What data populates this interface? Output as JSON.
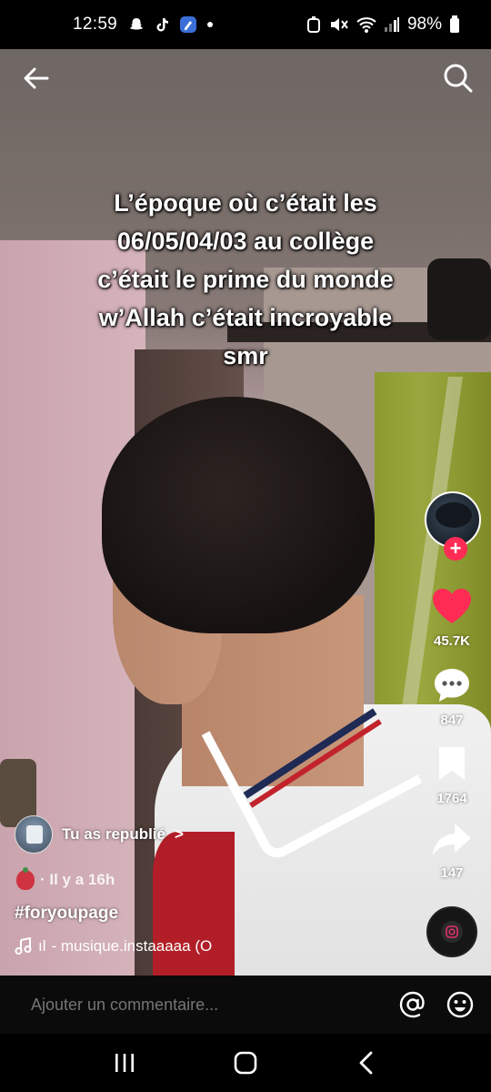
{
  "status_bar": {
    "time": "12:59",
    "battery": "98%",
    "notification_icons": [
      "snapchat-icon",
      "tiktok-icon",
      "app-icon",
      "dot-icon"
    ],
    "system_icons": [
      "alarm-icon",
      "mute-icon",
      "wifi-icon",
      "signal-icon",
      "battery-icon"
    ]
  },
  "top_nav": {
    "back_icon": "back-arrow-icon",
    "search_icon": "search-icon"
  },
  "video": {
    "caption_lines": [
      "L’époque où c’était les",
      "06/05/04/03 au collège",
      "c’était le prime du monde",
      "w’Allah c’était incroyable",
      "smr"
    ]
  },
  "rail": {
    "likes": "45.7K",
    "comments": "847",
    "bookmarks": "1764",
    "shares": "147",
    "follow_symbol": "+"
  },
  "post": {
    "repost_label": "Tu as republié",
    "repost_chevron": ">",
    "time_ago": "· Il y a 16h",
    "hashtag": "#foryoupage",
    "music_prefix": "ıl",
    "music_text": "- musique.instaaaaa (O"
  },
  "comment_bar": {
    "placeholder": "Ajouter un commentaire..."
  },
  "colors": {
    "like_red": "#fe2c55",
    "follow_red": "#fe2c55",
    "comment_bar_bg": "#0b0b0b"
  }
}
